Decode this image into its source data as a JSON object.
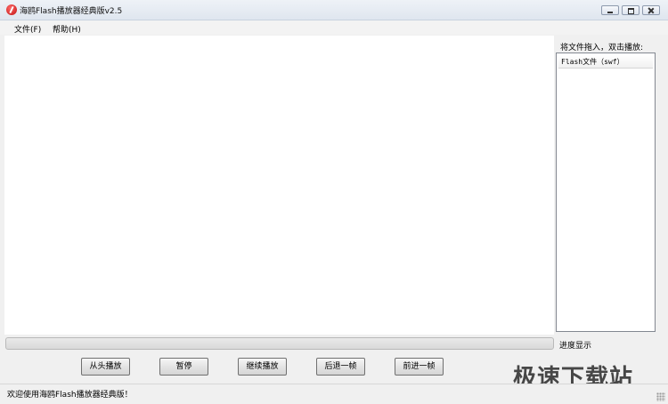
{
  "window": {
    "title": "海鸥Flash播放器经典版v2.5",
    "icon": "flash-app-icon"
  },
  "menu": {
    "file": "文件(F)",
    "help": "帮助(H)"
  },
  "sidebar": {
    "drag_hint": "将文件拖入，双击播放:",
    "list_header": "Flash文件（swf）"
  },
  "progress": {
    "label": "进度显示",
    "value_percent": 0,
    "fill_color": "#06b025"
  },
  "controls": {
    "restart": "从头播放",
    "pause": "暂停",
    "resume": "继续播放",
    "back_frame": "后退一帧",
    "forward_frame": "前进一帧"
  },
  "watermark": "极速下载站",
  "status": "欢迎使用海鸥Flash播放器经典版！"
}
